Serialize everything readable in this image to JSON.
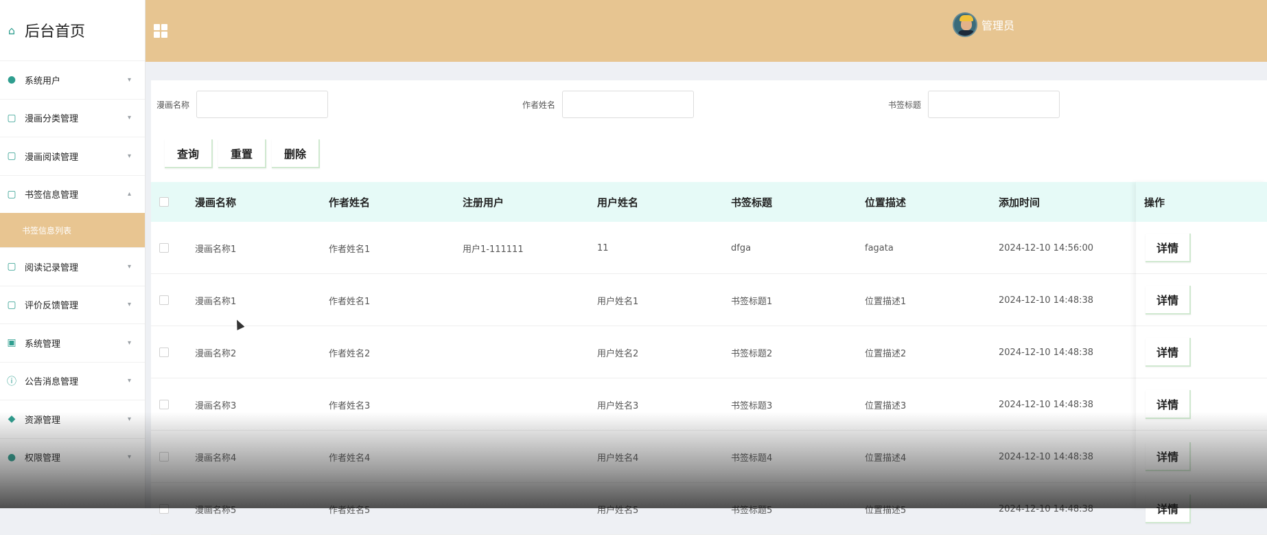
{
  "sidebar": {
    "brand": "后台首页",
    "items": [
      {
        "label": "系统用户",
        "icon": "user-icon"
      },
      {
        "label": "漫画分类管理",
        "icon": "book-icon"
      },
      {
        "label": "漫画阅读管理",
        "icon": "book-icon"
      },
      {
        "label": "书签信息管理",
        "icon": "book-icon",
        "expanded": true,
        "sub": "书签信息列表"
      },
      {
        "label": "阅读记录管理",
        "icon": "book-icon"
      },
      {
        "label": "评价反馈管理",
        "icon": "book-icon"
      },
      {
        "label": "系统管理",
        "icon": "image-icon"
      },
      {
        "label": "公告消息管理",
        "icon": "info-icon"
      },
      {
        "label": "资源管理",
        "icon": "pin-icon"
      },
      {
        "label": "权限管理",
        "icon": "user-icon"
      }
    ]
  },
  "header": {
    "user_name": "管理员"
  },
  "filters": {
    "comic_name_label": "漫画名称",
    "author_label": "作者姓名",
    "bookmark_title_label": "书签标题",
    "comic_name_value": "",
    "author_value": "",
    "bookmark_title_value": ""
  },
  "actions": {
    "query": "查询",
    "reset": "重置",
    "delete": "删除"
  },
  "table": {
    "columns": [
      "漫画名称",
      "作者姓名",
      "注册用户",
      "用户姓名",
      "书签标题",
      "位置描述",
      "添加时间",
      "操作"
    ],
    "rows": [
      [
        "漫画名称1",
        "作者姓名1",
        "用户1-111111",
        "11",
        "dfga",
        "fagata",
        "2024-12-10 14:56:00"
      ],
      [
        "漫画名称1",
        "作者姓名1",
        "",
        "用户姓名1",
        "书签标题1",
        "位置描述1",
        "2024-12-10 14:48:38"
      ],
      [
        "漫画名称2",
        "作者姓名2",
        "",
        "用户姓名2",
        "书签标题2",
        "位置描述2",
        "2024-12-10 14:48:38"
      ],
      [
        "漫画名称3",
        "作者姓名3",
        "",
        "用户姓名3",
        "书签标题3",
        "位置描述3",
        "2024-12-10 14:48:38"
      ],
      [
        "漫画名称4",
        "作者姓名4",
        "",
        "用户姓名4",
        "书签标题4",
        "位置描述4",
        "2024-12-10 14:48:38"
      ],
      [
        "漫画名称5",
        "作者姓名5",
        "",
        "用户姓名5",
        "书签标题5",
        "位置描述5",
        "2024-12-10 14:48:38"
      ]
    ],
    "detail_label": "详情"
  }
}
